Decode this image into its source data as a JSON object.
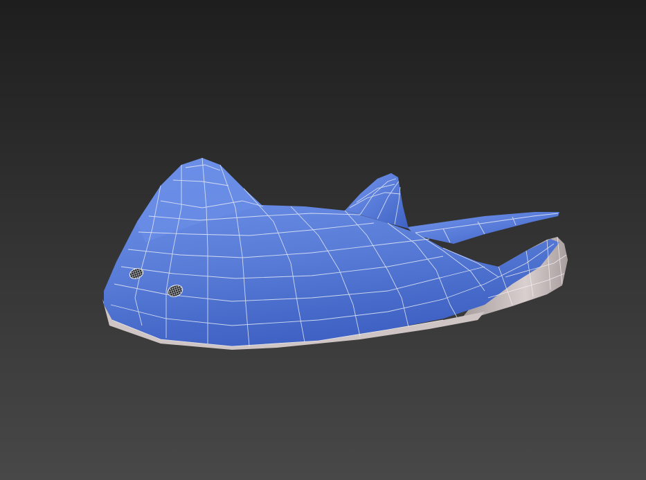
{
  "viewport": {
    "background_top": "#1e1e1e",
    "background_bottom": "#484848"
  },
  "model": {
    "subject": "stingray-mesh",
    "body_color": "#5b7fd9",
    "body_color_light": "#7396ee",
    "body_color_dark": "#3f62c4",
    "underside_color": "#d9cfcf",
    "underside_shadow": "#a99e9e",
    "wire_color": "#e8ecf6",
    "spiracle_color": "#1a1a1a"
  }
}
